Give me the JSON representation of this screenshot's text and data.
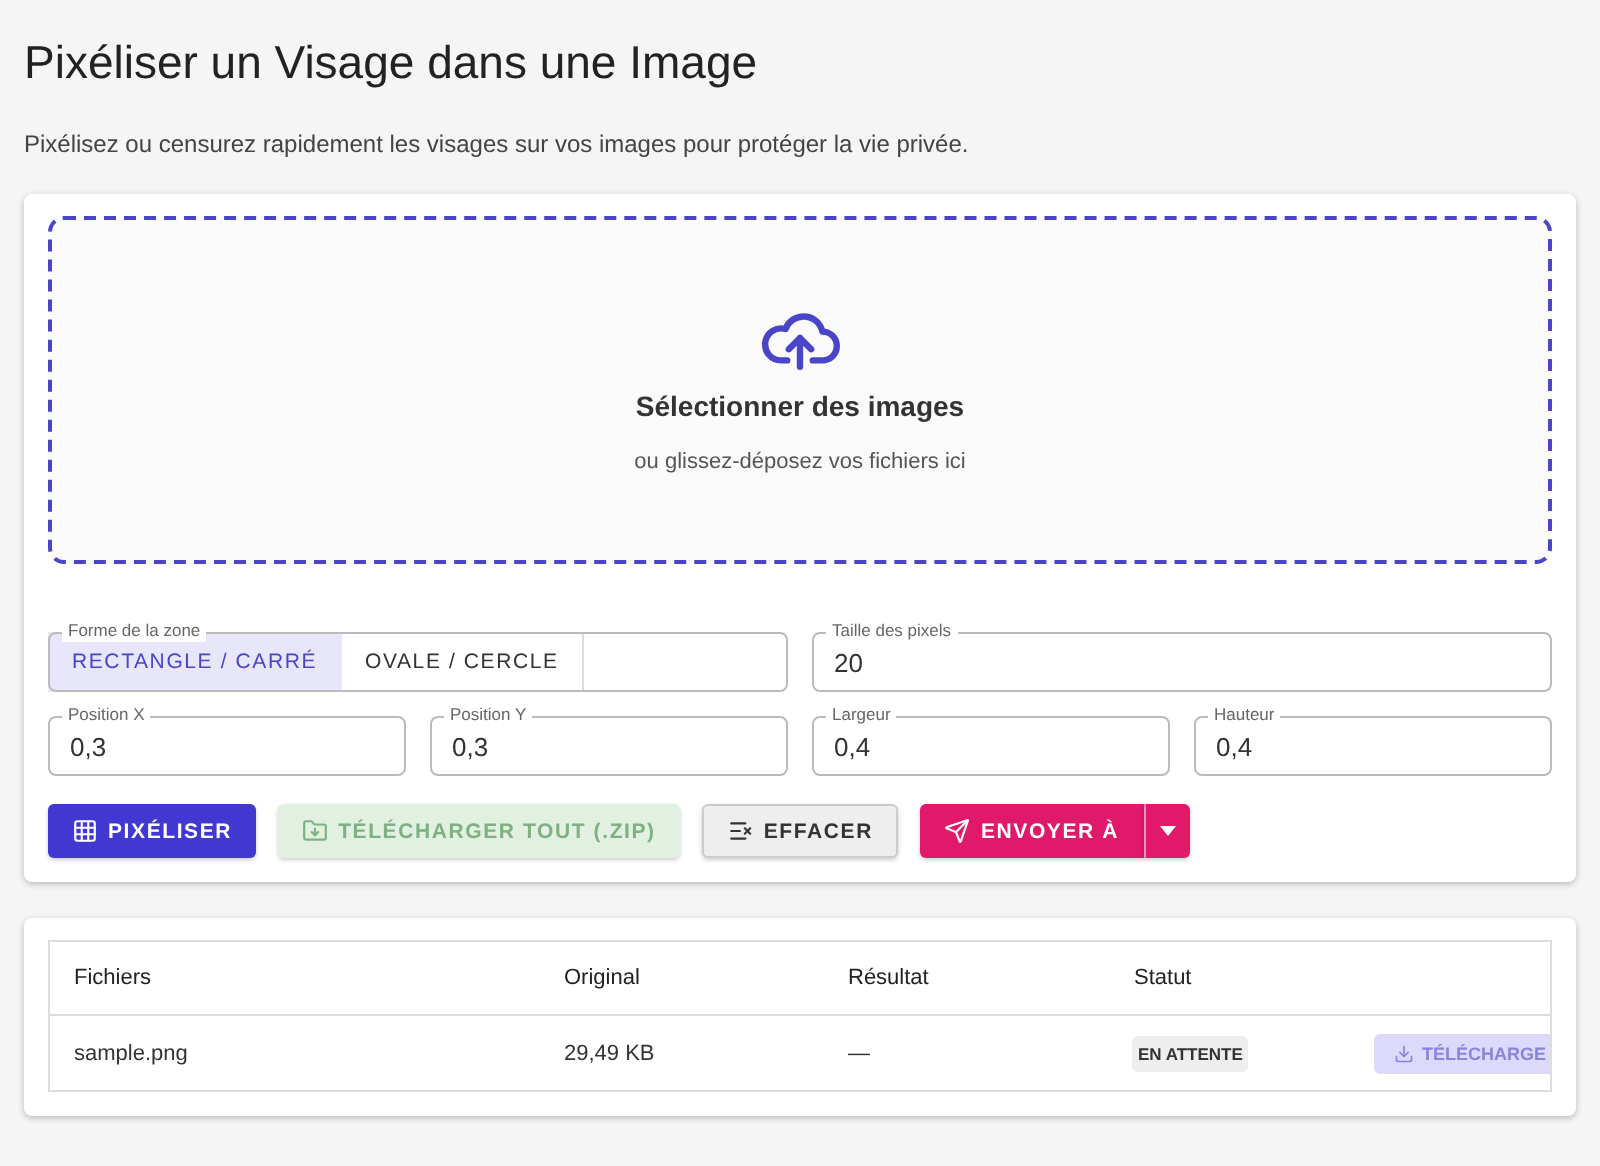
{
  "title": "Pixéliser un Visage dans une Image",
  "subtitle": "Pixélisez ou censurez rapidement les visages sur vos images pour protéger la vie privée.",
  "dropzone": {
    "title": "Sélectionner des images",
    "hint": "ou glissez-déposez vos fichiers ici"
  },
  "shape": {
    "label": "Forme de la zone",
    "options": [
      {
        "label": "RECTANGLE / CARRÉ",
        "selected": true
      },
      {
        "label": "OVALE / CERCLE",
        "selected": false
      }
    ]
  },
  "pixel_size": {
    "label": "Taille des pixels",
    "value": "20"
  },
  "fields": [
    {
      "label": "Position X",
      "value": "0,3"
    },
    {
      "label": "Position Y",
      "value": "0,3"
    },
    {
      "label": "Largeur",
      "value": "0,4"
    },
    {
      "label": "Hauteur",
      "value": "0,4"
    }
  ],
  "buttons": [
    {
      "kind": "pixelate",
      "label": "PIXÉLISER",
      "disabled": false
    },
    {
      "kind": "zip",
      "label": "TÉLÉCHARGER TOUT (.ZIP)",
      "disabled": true
    },
    {
      "kind": "clear",
      "label": "EFFACER",
      "disabled": false
    },
    {
      "kind": "send",
      "label": "ENVOYER À",
      "disabled": false
    }
  ],
  "table": {
    "columns": [
      "Fichiers",
      "Original",
      "Résultat",
      "Statut"
    ],
    "rows": [
      {
        "file": "sample.png",
        "original": "29,49 KB",
        "result": "—",
        "status": "EN ATTENTE",
        "download": {
          "label": "TÉLÉCHARGE",
          "disabled": true
        }
      }
    ]
  }
}
